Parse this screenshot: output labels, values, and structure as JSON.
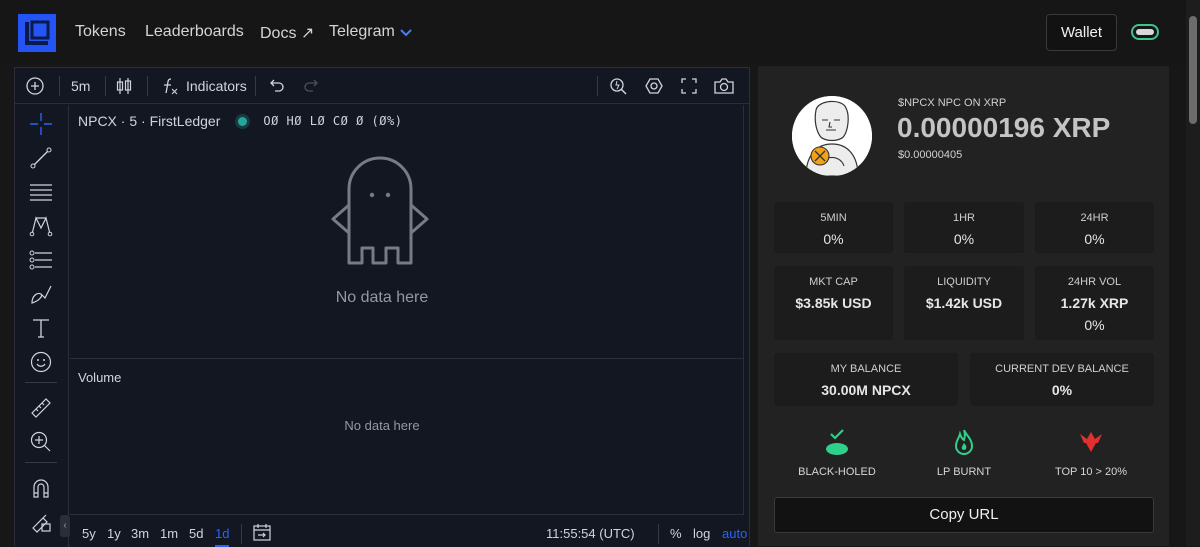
{
  "nav": {
    "items": [
      {
        "label": "Tokens"
      },
      {
        "label": "Leaderboards"
      },
      {
        "label": "Docs ↗"
      },
      {
        "label": "Telegram"
      }
    ],
    "wallet_label": "Wallet"
  },
  "chart": {
    "interval": "5m",
    "indicators_label": "Indicators",
    "symbol": "NPCX · 5 · FirstLedger",
    "ohlc": "OØ HØ LØ CØ Ø (Ø%)",
    "no_data_main": "No data here",
    "volume_label": "Volume",
    "no_data_volume": "No data here",
    "ranges": [
      "5y",
      "1y",
      "3m",
      "1m",
      "5d",
      "1d"
    ],
    "active_range": "1d",
    "time": "11:55:54 (UTC)",
    "percent_label": "%",
    "log_label": "log",
    "auto_label": "auto"
  },
  "token": {
    "name": "$NPCX NPC ON XRP",
    "price": "0.00000196 XRP",
    "price_usd": "$0.00000405",
    "changes": [
      {
        "label": "5MIN",
        "value": "0%"
      },
      {
        "label": "1HR",
        "value": "0%"
      },
      {
        "label": "24HR",
        "value": "0%"
      }
    ],
    "market": [
      {
        "label": "MKT CAP",
        "value": "$3.85k USD"
      },
      {
        "label": "LIQUIDITY",
        "value": "$1.42k USD"
      },
      {
        "label": "24HR VOL",
        "value": "1.27k XRP",
        "sub": "0%"
      }
    ],
    "balances": [
      {
        "label": "MY BALANCE",
        "value": "30.00M NPCX"
      },
      {
        "label": "CURRENT DEV BALANCE",
        "value": "0%"
      }
    ],
    "badges": [
      {
        "label": "BLACK-HOLED",
        "icon": "black-hole-check-icon",
        "color": "#2fd08a"
      },
      {
        "label": "LP BURNT",
        "icon": "flame-icon",
        "color": "#2fd08a"
      },
      {
        "label": "TOP 10 > 20%",
        "icon": "red-hand-icon",
        "color": "#e0312e"
      }
    ],
    "copy_label": "Copy URL"
  },
  "colors": {
    "accent": "#2455f4",
    "positive": "#2fd08a",
    "negative": "#e0312e",
    "chart_bg": "#131722"
  }
}
